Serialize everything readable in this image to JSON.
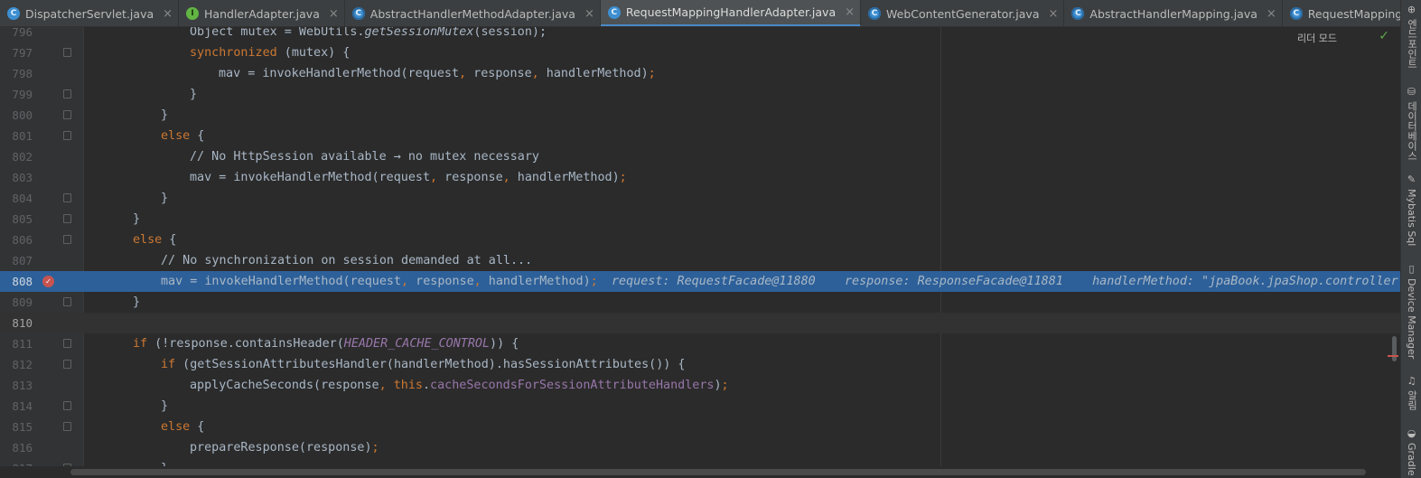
{
  "tabs": [
    {
      "label": "DispatcherServlet.java",
      "icon": "class-icon",
      "active": false
    },
    {
      "label": "HandlerAdapter.java",
      "icon": "interface-icon",
      "active": false
    },
    {
      "label": "AbstractHandlerMethodAdapter.java",
      "icon": "abstract-class-icon",
      "active": false
    },
    {
      "label": "RequestMappingHandlerAdapter.java",
      "icon": "class-icon",
      "active": true
    },
    {
      "label": "WebContentGenerator.java",
      "icon": "abstract-class-icon",
      "active": false
    },
    {
      "label": "AbstractHandlerMapping.java",
      "icon": "abstract-class-icon",
      "active": false
    },
    {
      "label": "RequestMappingInfoHandlerMapping.java",
      "icon": "abstract-class-icon",
      "active": false
    }
  ],
  "tab_close_glyph": "×",
  "tab_icon_letters": {
    "class": "C",
    "interface": "I"
  },
  "editor": {
    "reader_mode_label": "리더 모드",
    "executing_line": "808",
    "caret_line": "810",
    "lines": [
      {
        "num": "796",
        "text": "        Object mutex = WebUtils.getSessionMutex(session);"
      },
      {
        "num": "797",
        "text": "        synchronized (mutex) {"
      },
      {
        "num": "798",
        "text": "            mav = invokeHandlerMethod(request, response, handlerMethod);"
      },
      {
        "num": "799",
        "text": "        }"
      },
      {
        "num": "800",
        "text": "    }"
      },
      {
        "num": "801",
        "text": "    else {"
      },
      {
        "num": "802",
        "text": "        // No HttpSession available → no mutex necessary"
      },
      {
        "num": "803",
        "text": "        mav = invokeHandlerMethod(request, response, handlerMethod);"
      },
      {
        "num": "804",
        "text": "    }"
      },
      {
        "num": "805",
        "text": "}"
      },
      {
        "num": "806",
        "text": "else {"
      },
      {
        "num": "807",
        "text": "    // No synchronization on session demanded at all..."
      },
      {
        "num": "808",
        "text": "    mav = invokeHandlerMethod(request, response, handlerMethod);"
      },
      {
        "num": "809",
        "text": "}"
      },
      {
        "num": "810",
        "text": ""
      },
      {
        "num": "811",
        "text": "if (!response.containsHeader(HEADER_CACHE_CONTROL)) {"
      },
      {
        "num": "812",
        "text": "    if (getSessionAttributesHandler(handlerMethod).hasSessionAttributes()) {"
      },
      {
        "num": "813",
        "text": "        applyCacheSeconds(response, this.cacheSecondsForSessionAttributeHandlers);"
      },
      {
        "num": "814",
        "text": "    }"
      },
      {
        "num": "815",
        "text": "    else {"
      },
      {
        "num": "816",
        "text": "        prepareResponse(response);"
      },
      {
        "num": "817",
        "text": "    }"
      }
    ],
    "inline_values": "request: RequestFacade@11880    response: ResponseFacade@11881    handlerMethod: \"jpaBook.jpaShop.controller."
  },
  "tool_windows": [
    {
      "label": "엔드포인트",
      "icon": "endpoints-icon"
    },
    {
      "label": "데이터베이스",
      "icon": "database-icon"
    },
    {
      "label": "Mybatis Sql",
      "icon": "mybatis-icon"
    },
    {
      "label": "Device Manager",
      "icon": "device-manager-icon"
    },
    {
      "label": "알림",
      "icon": "notifications-icon"
    },
    {
      "label": "Gradle",
      "icon": "gradle-icon"
    }
  ],
  "colors": {
    "keyword": "#cc7832",
    "comment": "#808080",
    "constant": "#9876aa",
    "execution_line": "#2d6099",
    "breakpoint": "#c75450",
    "default_text": "#a9b7c6"
  }
}
